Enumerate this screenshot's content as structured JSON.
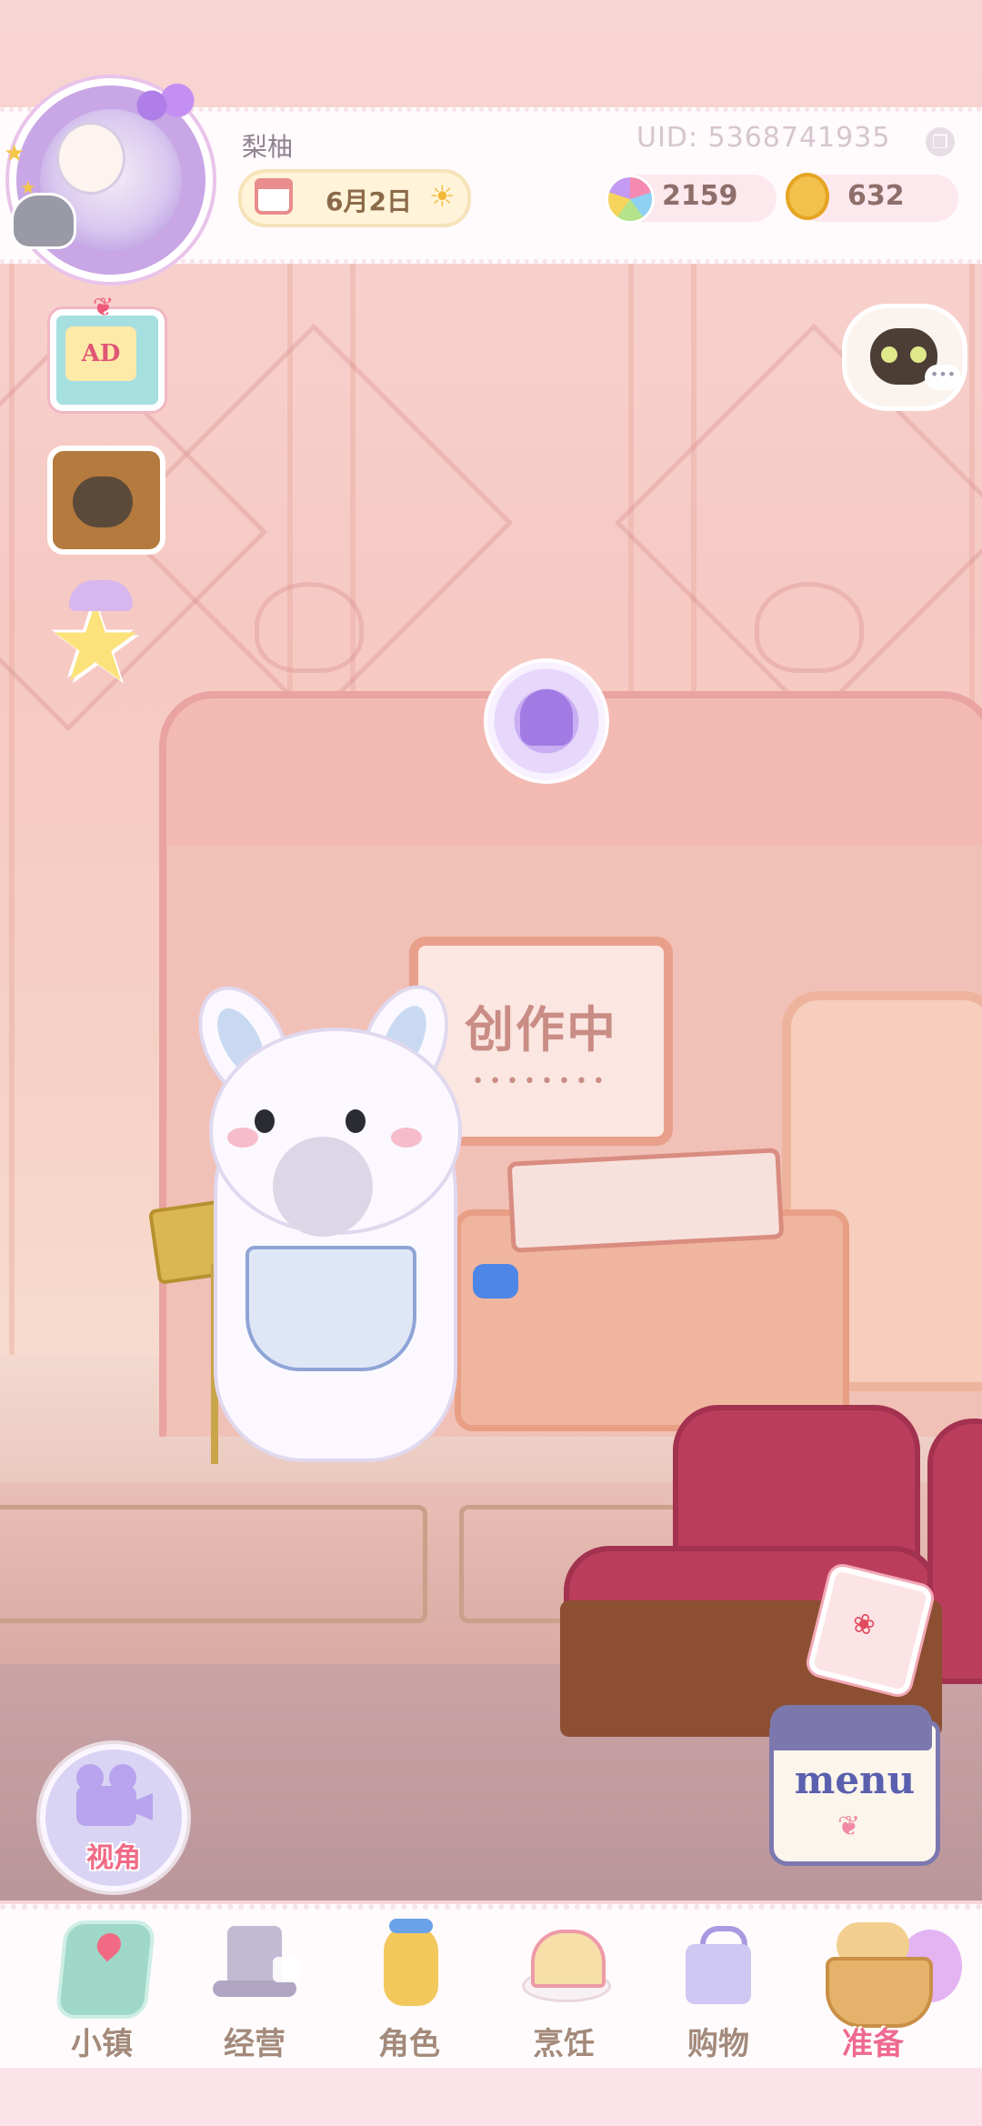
{
  "player": {
    "name": "梨柚",
    "uid": "UID: 5368741935",
    "date": "6月2日"
  },
  "resources": {
    "gems": "2159",
    "coins": "632"
  },
  "side_buttons": {
    "ad_label": "AD",
    "camera_label": "视角",
    "menu_label": "menu"
  },
  "scene": {
    "sign_text": "创作中",
    "sign_dots": "••••••••"
  },
  "nav": {
    "items": [
      {
        "label": "小镇",
        "icon": "map-icon"
      },
      {
        "label": "经营",
        "icon": "hat-icon",
        "locked": true
      },
      {
        "label": "角色",
        "icon": "character-icon"
      },
      {
        "label": "烹饪",
        "icon": "sandwich-icon"
      },
      {
        "label": "购物",
        "icon": "shopping-bag-icon"
      },
      {
        "label": "准备",
        "icon": "basket-icon",
        "active": true
      }
    ]
  },
  "colors": {
    "accent_pink": "#ef6a90",
    "wall": "#f6c9c3",
    "seat": "#bb3d5d"
  }
}
